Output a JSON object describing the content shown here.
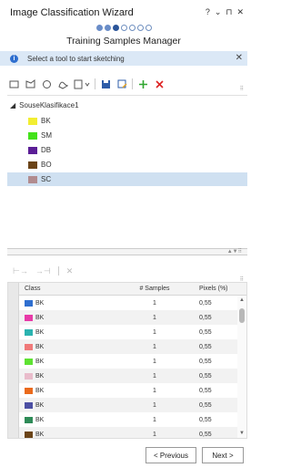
{
  "window": {
    "title": "Image Classification Wizard",
    "controls": [
      "?",
      "⌄",
      "⊓",
      "✕"
    ]
  },
  "wizard": {
    "steps_total": 7,
    "current_step": 3,
    "subtitle": "Training Samples Manager"
  },
  "infobar": {
    "message": "Select a tool to start sketching"
  },
  "tree": {
    "root_label": "SouseKlasifikace1",
    "items": [
      {
        "label": "BK",
        "color": "#f2ee32"
      },
      {
        "label": "SM",
        "color": "#43e21a"
      },
      {
        "label": "DB",
        "color": "#5b1e96"
      },
      {
        "label": "BO",
        "color": "#6b4418"
      },
      {
        "label": "SC",
        "color": "#b18c8f"
      }
    ],
    "selected_index": 4
  },
  "table": {
    "columns": [
      "Class",
      "# Samples",
      "Pixels (%)"
    ],
    "rows": [
      {
        "class": "BK",
        "samples": "1",
        "pixels": "0,55",
        "color": "#2f6fd0"
      },
      {
        "class": "BK",
        "samples": "1",
        "pixels": "0,55",
        "color": "#e83aa8"
      },
      {
        "class": "BK",
        "samples": "1",
        "pixels": "0,55",
        "color": "#2bb3b0"
      },
      {
        "class": "BK",
        "samples": "1",
        "pixels": "0,55",
        "color": "#f07a7a"
      },
      {
        "class": "BK",
        "samples": "1",
        "pixels": "0,55",
        "color": "#5ee232"
      },
      {
        "class": "BK",
        "samples": "1",
        "pixels": "0,55",
        "color": "#e9bccb"
      },
      {
        "class": "BK",
        "samples": "1",
        "pixels": "0,55",
        "color": "#ea6a1c"
      },
      {
        "class": "BK",
        "samples": "1",
        "pixels": "0,55",
        "color": "#4c4fa3"
      },
      {
        "class": "BK",
        "samples": "1",
        "pixels": "0,55",
        "color": "#2e8b57"
      },
      {
        "class": "BK",
        "samples": "1",
        "pixels": "0,55",
        "color": "#6b4418"
      }
    ]
  },
  "buttons": {
    "previous": "< Previous",
    "next": "Next >"
  }
}
